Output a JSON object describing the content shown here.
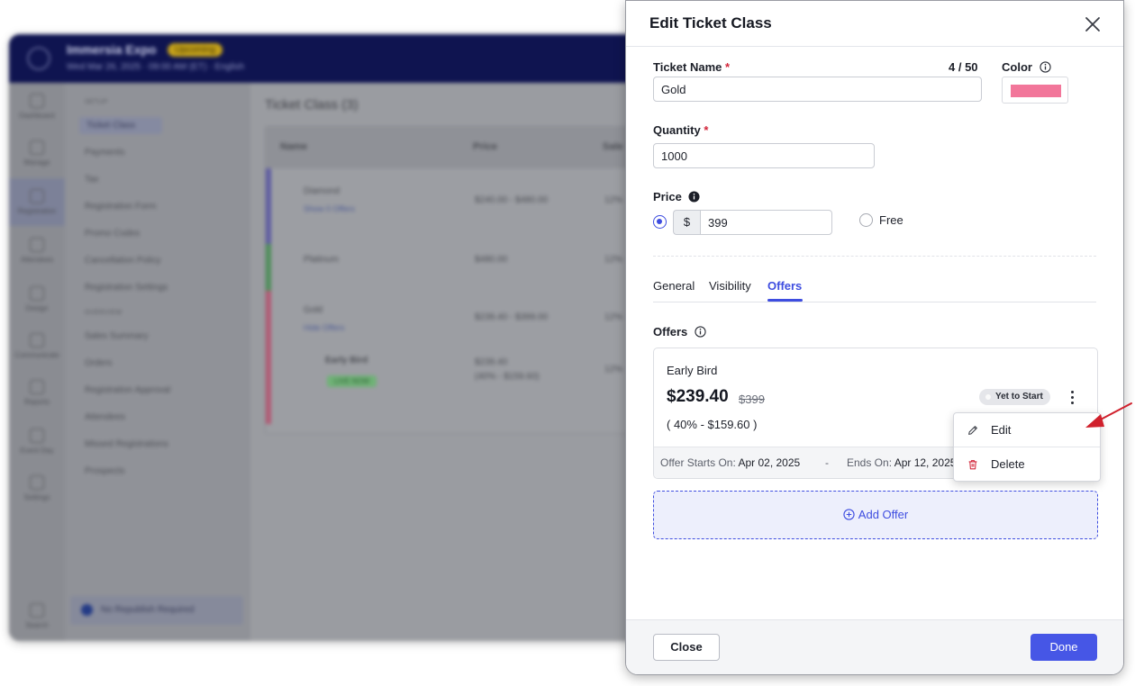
{
  "background_app": {
    "event_name": "Immersia Expo",
    "event_badge": "Upcoming",
    "event_subtitle": "Wed Mar 26, 2025 · 09:00 AM (ET) · English",
    "rail_items": [
      "Dashboard",
      "Manage",
      "Registration",
      "Attendees",
      "Design",
      "Communicate",
      "Reports",
      "Event Day",
      "Settings"
    ],
    "rail_footer": "Search",
    "side_group_setup": "SETUP",
    "side_group_overview": "OVERVIEW",
    "side_items_setup": [
      "Ticket Class",
      "Payments",
      "Tax",
      "Registration Form",
      "Promo Codes",
      "Cancellation Policy",
      "Registration Settings"
    ],
    "side_items_overview": [
      "Sales Summary",
      "Orders",
      "Registration Approval",
      "Attendees",
      "Missed Registrations",
      "Prospects"
    ],
    "side_footer": "No Republish Required",
    "main_title": "Ticket Class (3)",
    "table_headers": [
      "Name",
      "Price",
      "Sale"
    ],
    "rows": [
      {
        "name": "Diamond",
        "link": "Show 0 Offers",
        "price": "$240.00 - $480.00",
        "sale": "12%"
      },
      {
        "name": "Platinum",
        "link": "",
        "price": "$480.00",
        "sale": "12%"
      },
      {
        "name": "Gold",
        "link": "Hide Offers",
        "price": "$239.40 - $399.00",
        "sale": "12%"
      }
    ],
    "sub_row": {
      "name": "Early Bird",
      "tag": "LIVE NOW",
      "price1": "$239.40",
      "price2": "(40% - $159.60)",
      "sale": "12%"
    }
  },
  "modal": {
    "title": "Edit Ticket Class",
    "ticket_name": {
      "label": "Ticket Name",
      "required": "*",
      "value": "Gold",
      "counter": "4 / 50"
    },
    "color": {
      "label": "Color",
      "value": "#f2769a"
    },
    "quantity": {
      "label": "Quantity",
      "required": "*",
      "value": "1000"
    },
    "price": {
      "label": "Price",
      "currency": "$",
      "value": "399",
      "free_label": "Free",
      "selected": "paid"
    },
    "tabs": [
      {
        "label": "General",
        "active": false
      },
      {
        "label": "Visibility",
        "active": false
      },
      {
        "label": "Offers",
        "active": true
      }
    ],
    "offers_label": "Offers",
    "offer": {
      "name": "Early Bird",
      "price": "$239.40",
      "original_price": "$399",
      "discount": "( 40% - $159.60 )",
      "status": "Yet to Start",
      "starts_label": "Offer Starts On:",
      "starts_value": "Apr 02, 2025",
      "separator": "-",
      "ends_label": "Ends On:",
      "ends_value": "Apr 12, 2025"
    },
    "menu": {
      "edit": "Edit",
      "delete": "Delete"
    },
    "add_offer": "Add Offer",
    "footer": {
      "close": "Close",
      "done": "Done"
    }
  },
  "colors": {
    "accent": "#3e4de0",
    "done_button": "#4656e6",
    "required": "#d2263a",
    "annotation_arrow": "#d0202c",
    "delete_icon": "#d2263a"
  }
}
